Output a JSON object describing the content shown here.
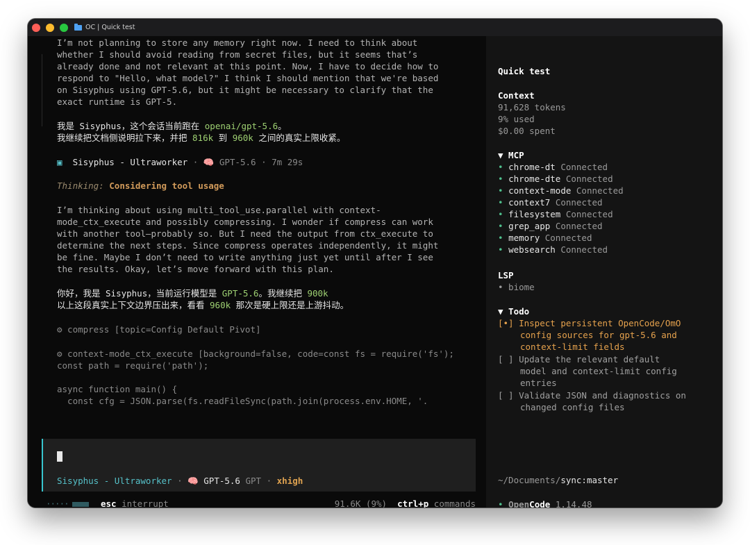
{
  "window": {
    "title": "OC | Quick test"
  },
  "main": {
    "reasoning_lines": [
      "I’m not planning to store any memory right now. I need to think about",
      "whether I should avoid reading from secret files, but it seems that’s",
      "already done and not relevant at this point. Now, I have to decide how to",
      "respond to \"Hello, what model?\" I think I should mention that we're based",
      "on Sisyphus using GPT-5.6, but it might be necessary to clarify that the",
      "exact runtime is GPT-5."
    ],
    "reply1": {
      "line1_pre": "我是 Sisyphus，这个会话当前跑在 ",
      "line1_model": "openai/gpt-5.6",
      "line1_post": "。",
      "line2_pre": "我继续把文档侧说明拉下来，并把 ",
      "line2_num1": "816k",
      "line2_mid": " 到 ",
      "line2_num2": "960k",
      "line2_post": " 之间的真实上限收紧。"
    },
    "status": {
      "agent": "Sisyphus - Ultraworker",
      "sep1": " · ",
      "model": "GPT-5.6",
      "sep2": " · ",
      "time": "7m 29s"
    },
    "thinking": {
      "label": "Thinking:",
      "title": "Considering tool usage"
    },
    "reasoning2_lines": [
      "I’m thinking about using multi_tool_use.parallel with context-",
      "mode_ctx_execute and possibly compressing. I wonder if compress can work",
      "with another tool—probably so. But I need the output from ctx_execute to",
      "determine the next steps. Since compress operates independently, it might",
      "be fine. Maybe I don’t need to write anything just yet until after I see",
      "the results. Okay, let’s move forward with this plan."
    ],
    "reply2": {
      "line1_pre": "你好，我是 Sisyphus，当前运行模型是 ",
      "line1_model": "GPT-5.6",
      "line1_mid": "。我继续把 ",
      "line1_num": "900k",
      "line2_pre": "以上这段真实上下文边界压出来，看看 ",
      "line2_num": "960k",
      "line2_post": " 那次是硬上限还是上游抖动。"
    },
    "tool_calls": [
      "⚙ compress [topic=Config Default Pivot]",
      "⚙ context-mode_ctx_execute [background=false, code=const fs = require('fs');"
    ],
    "code_lines": [
      "const path = require('path');",
      "",
      "async function main() {",
      "  const cfg = JSON.parse(fs.readFileSync(path.join(process.env.HOME, '."
    ]
  },
  "prompt": {
    "agent": "Sisyphus - Ultraworker",
    "sep": " · ",
    "model": "GPT-5.6",
    "provider": "GPT",
    "sep2": " · ",
    "effort": "xhigh"
  },
  "bottom": {
    "dots": "·····",
    "esc_key": "esc",
    "esc_label": " interrupt",
    "tokens": "91.6K (9%)",
    "cmd_key": "ctrl+p",
    "cmd_label": " commands"
  },
  "sidebar": {
    "title": "Quick test",
    "context": {
      "header": "Context",
      "tokens": "91,628 tokens",
      "used": "9% used",
      "spent": "$0.00 spent"
    },
    "mcp": {
      "header": "▼ MCP",
      "items": [
        {
          "name": "chrome-dt",
          "status": "Connected"
        },
        {
          "name": "chrome-dte",
          "status": "Connected"
        },
        {
          "name": "context-mode",
          "status": "Connected"
        },
        {
          "name": "context7",
          "status": "Connected"
        },
        {
          "name": "filesystem",
          "status": "Connected"
        },
        {
          "name": "grep_app",
          "status": "Connected"
        },
        {
          "name": "memory",
          "status": "Connected"
        },
        {
          "name": "websearch",
          "status": "Connected"
        }
      ]
    },
    "lsp": {
      "header": "LSP",
      "item": "• biome"
    },
    "todo": {
      "header": "▼ Todo",
      "items": [
        {
          "mark": "[•]",
          "lines": [
            "Inspect persistent OpenCode/OmO",
            "config sources for gpt-5.6 and",
            "context-limit fields"
          ]
        },
        {
          "mark": "[ ]",
          "lines": [
            "Update the relevant default",
            "model and context-limit config",
            "entries"
          ]
        },
        {
          "mark": "[ ]",
          "lines": [
            "Validate JSON and diagnostics on",
            "changed config files"
          ]
        }
      ]
    },
    "path": {
      "dir": "~/Documents/",
      "branch": "sync:master"
    },
    "version": {
      "bullet": "•",
      "open": "Open",
      "code": "Code",
      "num": "1.14.48"
    }
  }
}
